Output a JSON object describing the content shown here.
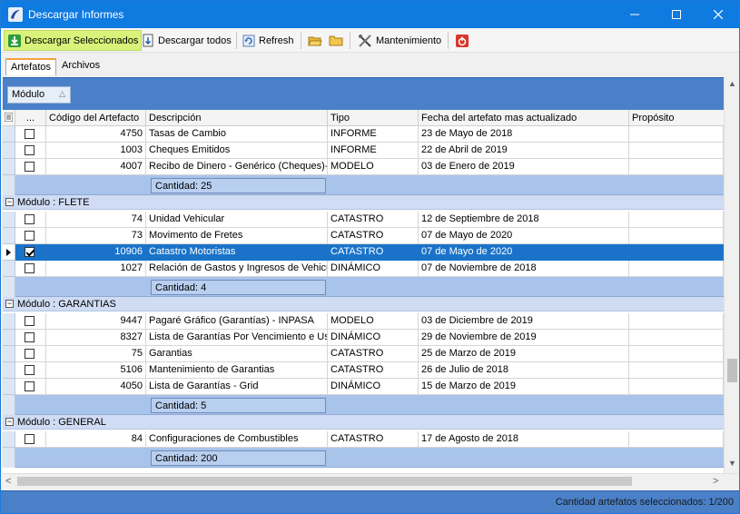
{
  "window": {
    "title": "Descargar Informes",
    "controls": {
      "minimize": "—",
      "maximize": "☐",
      "close": "✕"
    }
  },
  "toolbar": {
    "download_selected": "Descargar Seleccionados",
    "download_all": "Descargar todos",
    "refresh": "Refresh",
    "maintenance": "Mantenimiento"
  },
  "tabs": [
    {
      "label": "Artefatos",
      "active": true
    },
    {
      "label": "Archivos",
      "active": false
    }
  ],
  "grouping": {
    "chip_label": "Módulo",
    "sort_glyph": "△"
  },
  "columns": {
    "selector": "...",
    "code": "Código del Artefacto",
    "description": "Descripción",
    "type": "Tipo",
    "date": "Fecha del artefato mas actualizado",
    "purpose": "Propósito"
  },
  "groups": [
    {
      "label": "",
      "rows": [
        {
          "checked": false,
          "code": "4750",
          "description": "Tasas de Cambio",
          "type": "INFORME",
          "date": "23 de Mayo de 2018",
          "selected": false
        },
        {
          "checked": false,
          "code": "1003",
          "description": "Cheques Emitidos",
          "type": "INFORME",
          "date": "22 de Abril de 2019",
          "selected": false
        },
        {
          "checked": false,
          "code": "4007",
          "description": "Recibo de Dinero - Genérico (Cheques)-D",
          "type": "MODELO",
          "date": "03 de Enero de 2019",
          "selected": false
        }
      ],
      "summary": "Cantidad: 25"
    },
    {
      "label": "Módulo : FLETE",
      "rows": [
        {
          "checked": false,
          "code": "74",
          "description": "Unidad Vehicular",
          "type": "CATASTRO",
          "date": "12 de Septiembre de 2018",
          "selected": false
        },
        {
          "checked": false,
          "code": "73",
          "description": "Movimento de Fretes",
          "type": "CATASTRO",
          "date": "07 de Mayo de 2020",
          "selected": false
        },
        {
          "checked": true,
          "code": "10906",
          "description": "Catastro Motoristas",
          "type": "CATASTRO",
          "date": "07 de Mayo de 2020",
          "selected": true
        },
        {
          "checked": false,
          "code": "1027",
          "description": "Relación de Gastos y Ingresos de Vehicul",
          "type": "DINÁMICO",
          "date": "07 de Noviembre de 2018",
          "selected": false
        }
      ],
      "summary": "Cantidad: 4"
    },
    {
      "label": "Módulo : GARANTIAS",
      "rows": [
        {
          "checked": false,
          "code": "9447",
          "description": "Pagaré Gráfico (Garantías) - INPASA",
          "type": "MODELO",
          "date": "03 de Diciembre de 2019",
          "selected": false
        },
        {
          "checked": false,
          "code": "8327",
          "description": "Lista de Garantías Por Vencimiento e Usu",
          "type": "DINÁMICO",
          "date": "29 de Noviembre de 2019",
          "selected": false
        },
        {
          "checked": false,
          "code": "75",
          "description": "Garantias",
          "type": "CATASTRO",
          "date": "25 de Marzo de 2019",
          "selected": false
        },
        {
          "checked": false,
          "code": "5106",
          "description": "Mantenimiento de Garantias",
          "type": "CATASTRO",
          "date": "26 de Julio de 2018",
          "selected": false
        },
        {
          "checked": false,
          "code": "4050",
          "description": "Lista de Garantías - Grid",
          "type": "DINÁMICO",
          "date": "15 de Marzo de 2019",
          "selected": false
        }
      ],
      "summary": "Cantidad: 5"
    },
    {
      "label": "Módulo : GENERAL",
      "rows": [
        {
          "checked": false,
          "code": "84",
          "description": "Configuraciones de Combustibles",
          "type": "CATASTRO",
          "date": "17 de Agosto de 2018",
          "selected": false
        }
      ],
      "summary": "Cantidad: 200"
    }
  ],
  "status": {
    "text": "Cantidad artefatos seleccionados: 1/200"
  },
  "colors": {
    "titlebar": "#0f7ae0",
    "band": "#4a80c8",
    "selected_row": "#1a73c9",
    "summary_row": "#a9c4eb",
    "group_row": "#cfdcf3",
    "active_button": "#d9f27a"
  }
}
